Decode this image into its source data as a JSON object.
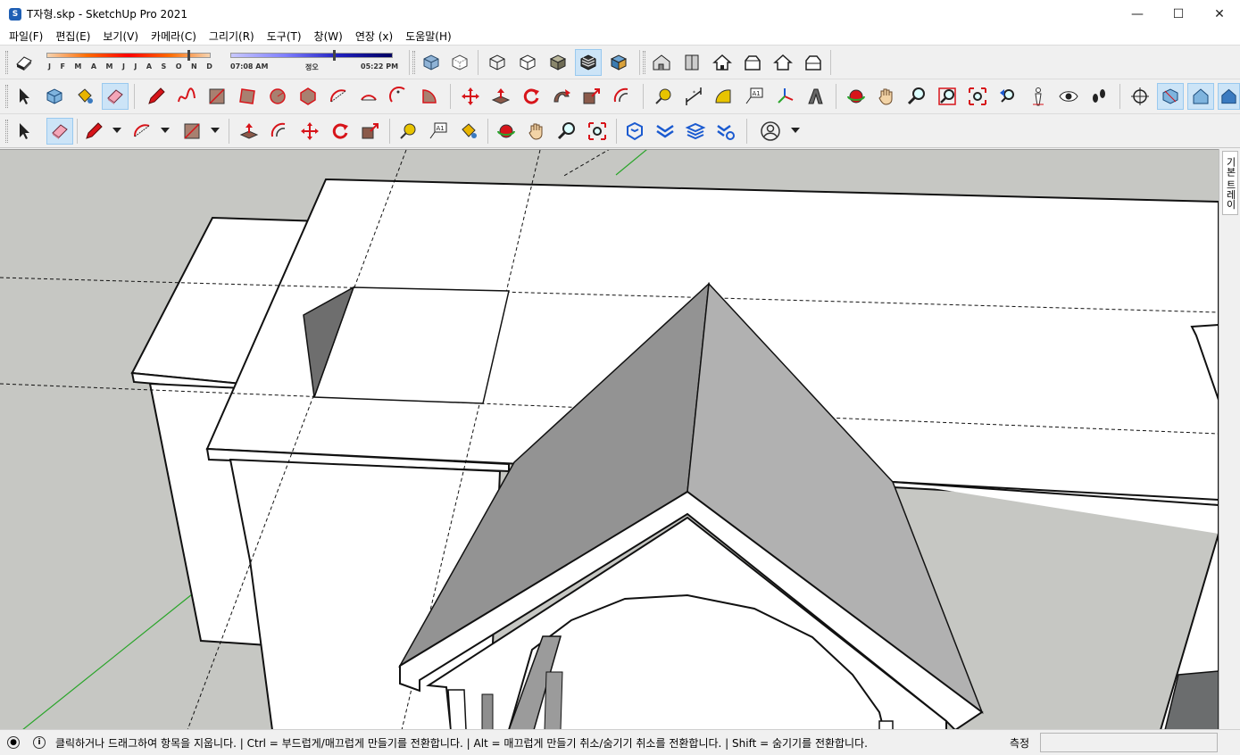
{
  "window": {
    "title": "T자형.skp - SketchUp Pro 2021",
    "minimize": "—",
    "maximize": "☐",
    "close": "✕"
  },
  "menu": [
    "파일(F)",
    "편집(E)",
    "보기(V)",
    "카메라(C)",
    "그리기(R)",
    "도구(T)",
    "창(W)",
    "연장 (x)",
    "도움말(H)"
  ],
  "shadows": {
    "months": [
      "J",
      "F",
      "M",
      "A",
      "M",
      "J",
      "J",
      "A",
      "S",
      "O",
      "N",
      "D"
    ],
    "time_start": "07:08 AM",
    "time_noon": "정오",
    "time_end": "05:22 PM"
  },
  "tray": {
    "tab_label": "기본 트레이"
  },
  "status": {
    "message": "클릭하거나 드래그하여 항목을 지웁니다. | Ctrl = 부드럽게/매끄럽게 만들기를 전환합니다. | Alt = 매끄럽게 만들기 취소/숨기기 취소를 전환합니다. | Shift = 숨기기를 전환합니다.",
    "measure_label": "측정",
    "measure_value": ""
  },
  "colors": {
    "accent_red": "#d7141a",
    "active_button": "#cce4f7",
    "viewport_bg": "#c6c7c3",
    "green_axis": "#2aa52a"
  }
}
